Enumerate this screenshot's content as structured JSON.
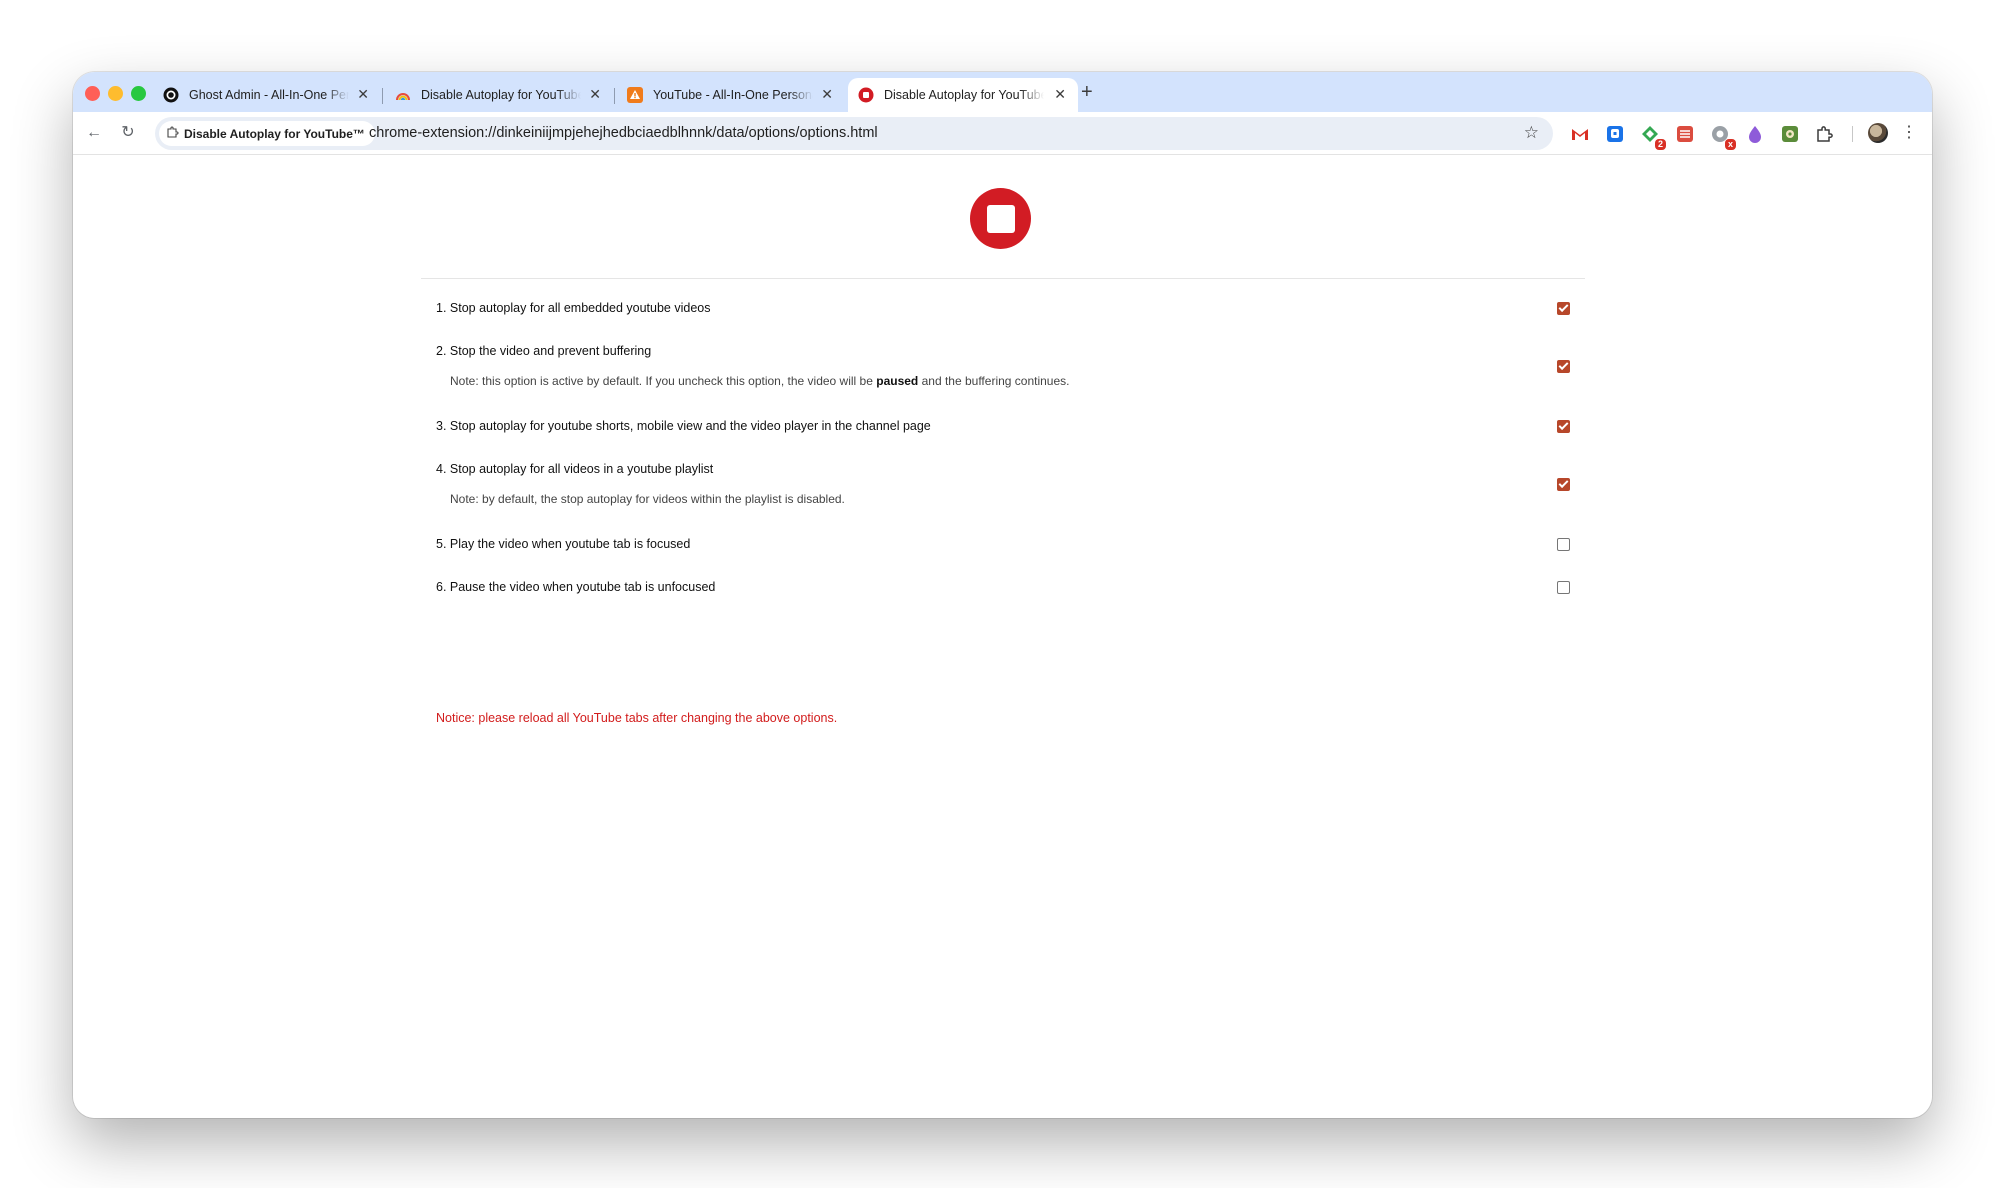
{
  "tabs": [
    {
      "title": "Ghost Admin - All-In-One Personal",
      "favicon": "ghost-icon",
      "active": false
    },
    {
      "title": "Disable Autoplay for YouTube™",
      "favicon": "rainbow-icon",
      "active": false
    },
    {
      "title": "YouTube - All-In-One Personal",
      "favicon": "warning-triangle-icon",
      "active": false
    },
    {
      "title": "Disable Autoplay for YouTube™",
      "favicon": "stop-icon",
      "active": true
    }
  ],
  "toolbar": {
    "back_icon": "←",
    "reload_icon": "↻",
    "site_chip": "Disable Autoplay for YouTube™",
    "url": "chrome-extension://dinkeiniijmpjehejhedbciaedblhnnk/data/options/options.html",
    "bookmark_icon": "☆",
    "new_tab_icon": "+",
    "close_icon": "✕",
    "menu_icon": "⋮",
    "extensions": [
      {
        "name": "gmail-icon",
        "badge": ""
      },
      {
        "name": "raindrop-icon",
        "badge": ""
      },
      {
        "name": "diff-icon",
        "badge": "2"
      },
      {
        "name": "todoist-icon",
        "badge": ""
      },
      {
        "name": "gray-circle-icon",
        "badge": "x"
      },
      {
        "name": "purple-drop-icon",
        "badge": ""
      },
      {
        "name": "green-map-icon",
        "badge": ""
      },
      {
        "name": "extensions-puzzle-icon",
        "badge": ""
      }
    ]
  },
  "options": [
    {
      "label": "1. Stop autoplay for all embedded youtube videos",
      "checked": true
    },
    {
      "label": "2. Stop the video and prevent buffering",
      "note_pre": "Note: this option is active by default. If you uncheck this option, the video will be ",
      "note_bold": "paused",
      "note_post": " and the buffering continues.",
      "checked": true
    },
    {
      "label": "3. Stop autoplay for youtube shorts, mobile view and the video player in the channel page",
      "checked": true
    },
    {
      "label": "4. Stop autoplay for all videos in a youtube playlist",
      "note_pre": "Note: by default, the stop autoplay for videos within the playlist is disabled.",
      "checked": true
    },
    {
      "label": "5. Play the video when youtube tab is focused",
      "checked": false
    },
    {
      "label": "6. Pause the video when youtube tab is unfocused",
      "checked": false
    }
  ],
  "notice": "Notice: please reload all YouTube tabs after changing the above options.",
  "colors": {
    "brand_red": "#d21c24",
    "checkbox_accent": "#b7472a",
    "tabstrip": "#d3e3fd"
  }
}
